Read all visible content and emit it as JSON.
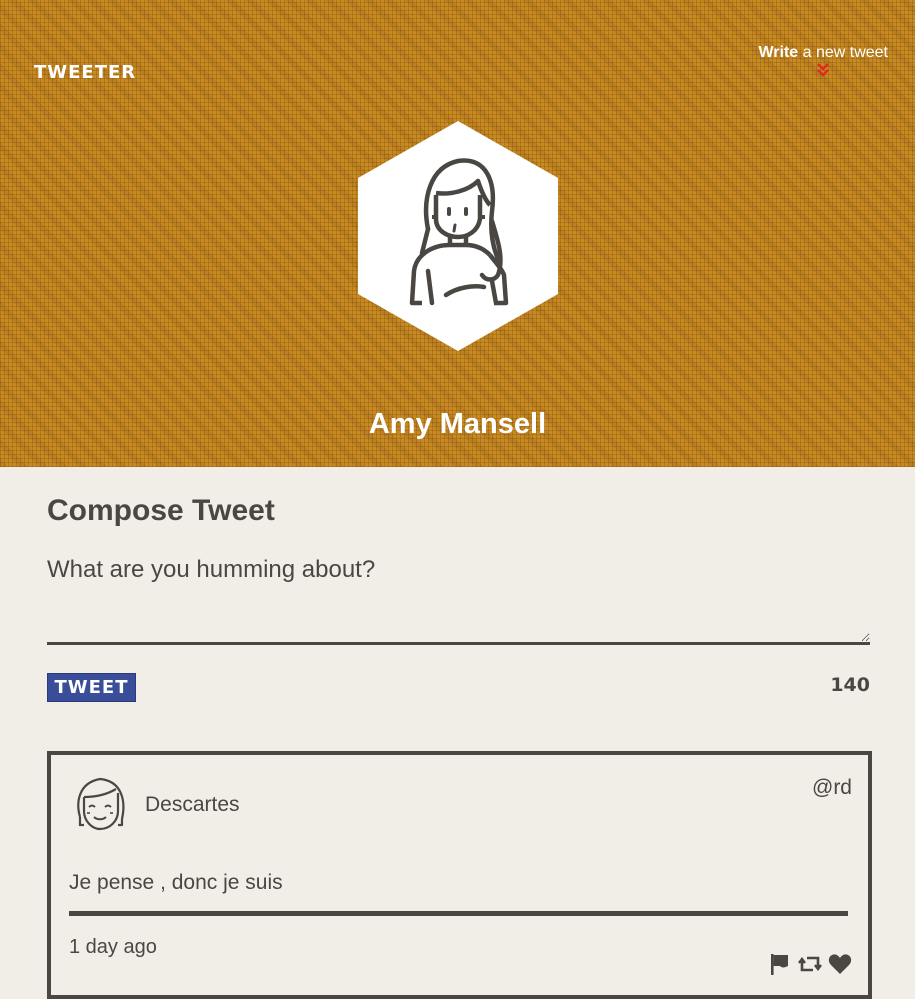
{
  "header": {
    "logo": "TWEETER",
    "write_link": {
      "bold": "Write",
      "rest": " a new tweet",
      "arrow_icon": "chevrons-down-icon",
      "arrow_color": "#e02a1f"
    },
    "avatar_icon": "person-avatar-icon",
    "user_name": "Amy Mansell",
    "background_color": "#c98a22"
  },
  "compose": {
    "title": "Compose Tweet",
    "placeholder": "What are you humming about?",
    "value": "",
    "button_label": "TWEET",
    "button_color": "#3a4d99",
    "char_count": "140"
  },
  "tweets": [
    {
      "avatar_icon": "smiling-face-avatar-icon",
      "name": "Descartes",
      "handle": "@rd",
      "content": "Je pense , donc je suis",
      "time": "1 day ago",
      "actions": [
        "flag-icon",
        "retweet-icon",
        "heart-icon"
      ]
    }
  ]
}
